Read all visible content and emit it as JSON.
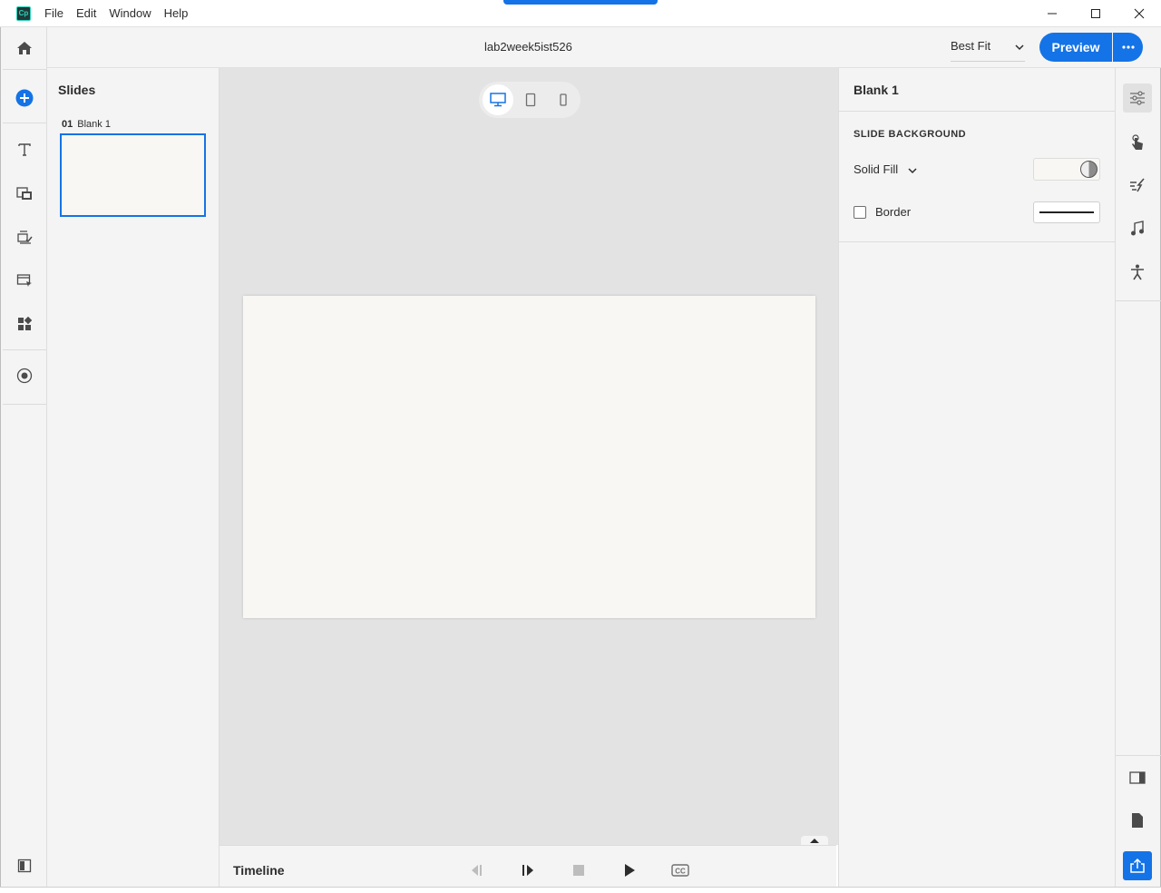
{
  "app": {
    "logo_text": "Cp",
    "menu": [
      "File",
      "Edit",
      "Window",
      "Help"
    ]
  },
  "header": {
    "document_title": "lab2week5ist526",
    "zoom_value": "Best Fit",
    "preview_label": "Preview"
  },
  "slides_panel": {
    "title": "Slides",
    "slides": [
      {
        "number": "01",
        "name": "Blank 1",
        "selected": true
      }
    ]
  },
  "canvas": {
    "device_modes": [
      "desktop",
      "tablet",
      "mobile"
    ],
    "active_device": "desktop",
    "stage_color": "#f8f7f4"
  },
  "timeline": {
    "title": "Timeline"
  },
  "properties": {
    "title": "Blank 1",
    "section_title": "SLIDE BACKGROUND",
    "fill_type": "Solid Fill",
    "border_label": "Border",
    "border_checked": false
  },
  "colors": {
    "accent": "#1473e6",
    "panel_bg": "#f4f4f4",
    "canvas_bg": "#e3e3e3"
  }
}
